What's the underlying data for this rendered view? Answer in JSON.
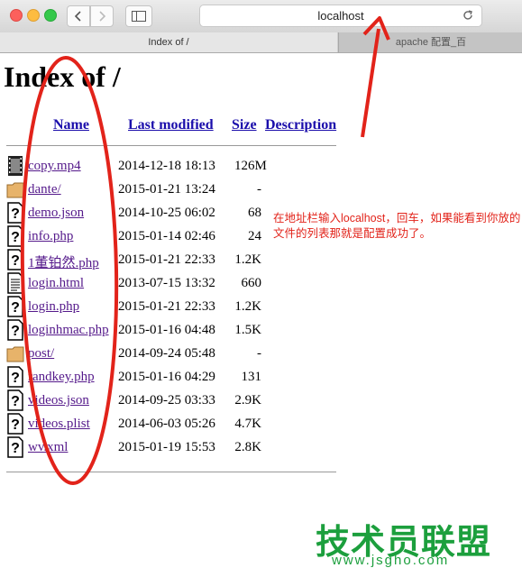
{
  "browser": {
    "url": "localhost",
    "tabs": [
      {
        "label": "Index of /"
      },
      {
        "label": "apache 配置_百"
      }
    ]
  },
  "page": {
    "title": "Index of /",
    "columns": [
      "Name",
      "Last modified",
      "Size",
      "Description"
    ],
    "files": [
      {
        "name": "copy.mp4",
        "modified": "2014-12-18 18:13",
        "size": "126M",
        "icon": "movie-icon"
      },
      {
        "name": "dante/",
        "modified": "2015-01-21 13:24",
        "size": "-",
        "icon": "folder-icon"
      },
      {
        "name": "demo.json",
        "modified": "2014-10-25 06:02",
        "size": "68",
        "icon": "unknown-file-icon"
      },
      {
        "name": "info.php",
        "modified": "2015-01-14 02:46",
        "size": "24",
        "icon": "unknown-file-icon"
      },
      {
        "name": "1董铂然.php",
        "modified": "2015-01-21 22:33",
        "size": "1.2K",
        "icon": "unknown-file-icon"
      },
      {
        "name": "login.html",
        "modified": "2013-07-15 13:32",
        "size": "660",
        "icon": "text-file-icon"
      },
      {
        "name": "login.php",
        "modified": "2015-01-21 22:33",
        "size": "1.2K",
        "icon": "unknown-file-icon"
      },
      {
        "name": "loginhmac.php",
        "modified": "2015-01-16 04:48",
        "size": "1.5K",
        "icon": "unknown-file-icon"
      },
      {
        "name": "post/",
        "modified": "2014-09-24 05:48",
        "size": "-",
        "icon": "folder-icon"
      },
      {
        "name": "randkey.php",
        "modified": "2015-01-16 04:29",
        "size": "131",
        "icon": "unknown-file-icon"
      },
      {
        "name": "videos.json",
        "modified": "2014-09-25 03:33",
        "size": "2.9K",
        "icon": "unknown-file-icon"
      },
      {
        "name": "videos.plist",
        "modified": "2014-06-03 05:26",
        "size": "4.7K",
        "icon": "unknown-file-icon"
      },
      {
        "name": "wv.xml",
        "modified": "2015-01-19 15:53",
        "size": "2.8K",
        "icon": "unknown-file-icon"
      }
    ]
  },
  "annotation": {
    "note": "在地址栏输入localhost，回车，如果能看到你放的文件的列表那就是配置成功了。",
    "color": "#e2231a"
  },
  "watermark": {
    "title": "技术员联盟",
    "url": "www.jsgho.com",
    "color": "#1c9f3d"
  }
}
